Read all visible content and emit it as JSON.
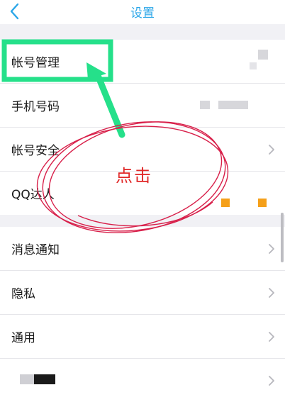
{
  "nav": {
    "title": "设置",
    "back_icon": "chevron-left-icon",
    "accent_color": "#2aa6e8"
  },
  "group1": {
    "items": [
      {
        "label": "帐号管理"
      },
      {
        "label": "手机号码"
      },
      {
        "label": "帐号安全"
      },
      {
        "label": "QQ达人"
      }
    ]
  },
  "group2": {
    "items": [
      {
        "label": "消息通知"
      },
      {
        "label": "隐私"
      },
      {
        "label": "通用"
      },
      {
        "label": ""
      }
    ]
  },
  "annotation": {
    "text": "点击",
    "highlight_color": "#25e08a",
    "ink_color": "#d8204a"
  }
}
